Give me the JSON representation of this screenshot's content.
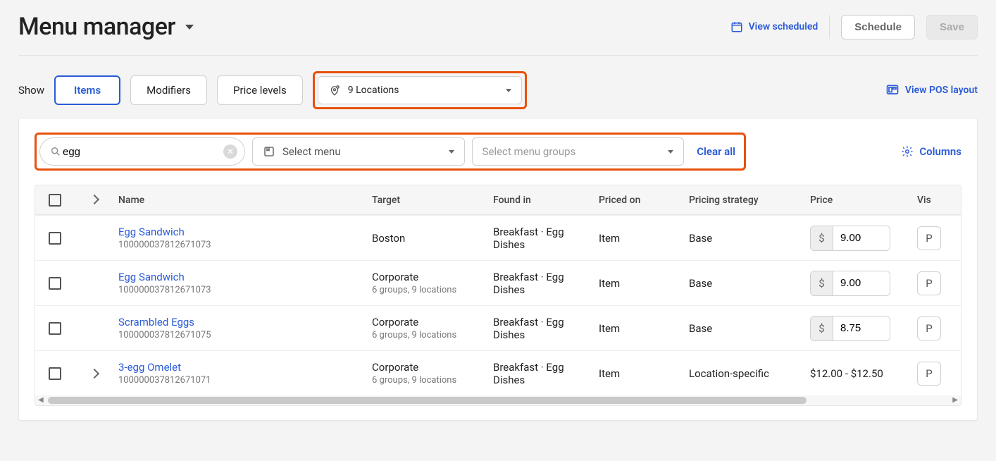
{
  "header": {
    "title": "Menu manager",
    "view_scheduled": "View scheduled",
    "schedule_btn": "Schedule",
    "save_btn": "Save"
  },
  "filters": {
    "show_label": "Show",
    "tabs": {
      "items": "Items",
      "modifiers": "Modifiers",
      "price_levels": "Price levels"
    },
    "locations_label": "9 Locations",
    "view_pos": "View POS layout"
  },
  "search": {
    "value": "egg",
    "select_menu_label": "Select menu",
    "select_groups_placeholder": "Select menu groups",
    "clear_all": "Clear all",
    "columns": "Columns"
  },
  "table": {
    "headers": {
      "name": "Name",
      "target": "Target",
      "found_in": "Found in",
      "priced_on": "Priced on",
      "strategy": "Pricing strategy",
      "price": "Price",
      "visibility": "Vis"
    },
    "currency": "$",
    "rows": [
      {
        "expandable": false,
        "name": "Egg Sandwich",
        "id": "100000037812671073",
        "target": "Boston",
        "target_sub": "",
        "found_in": "Breakfast · Egg Dishes",
        "priced_on": "Item",
        "strategy": "Base",
        "price_input": "9.00",
        "price_text": "",
        "vis": "P"
      },
      {
        "expandable": false,
        "name": "Egg Sandwich",
        "id": "100000037812671073",
        "target": "Corporate",
        "target_sub": "6 groups, 9 locations",
        "found_in": "Breakfast · Egg Dishes",
        "priced_on": "Item",
        "strategy": "Base",
        "price_input": "9.00",
        "price_text": "",
        "vis": "P"
      },
      {
        "expandable": false,
        "name": "Scrambled Eggs",
        "id": "100000037812671075",
        "target": "Corporate",
        "target_sub": "6 groups, 9 locations",
        "found_in": "Breakfast · Egg Dishes",
        "priced_on": "Item",
        "strategy": "Base",
        "price_input": "8.75",
        "price_text": "",
        "vis": "P"
      },
      {
        "expandable": true,
        "name": "3-egg Omelet",
        "id": "100000037812671071",
        "target": "Corporate",
        "target_sub": "6 groups, 9 locations",
        "found_in": "Breakfast · Egg Dishes",
        "priced_on": "Item",
        "strategy": "Location-specific",
        "price_input": "",
        "price_text": "$12.00 - $12.50",
        "vis": "P"
      }
    ]
  }
}
